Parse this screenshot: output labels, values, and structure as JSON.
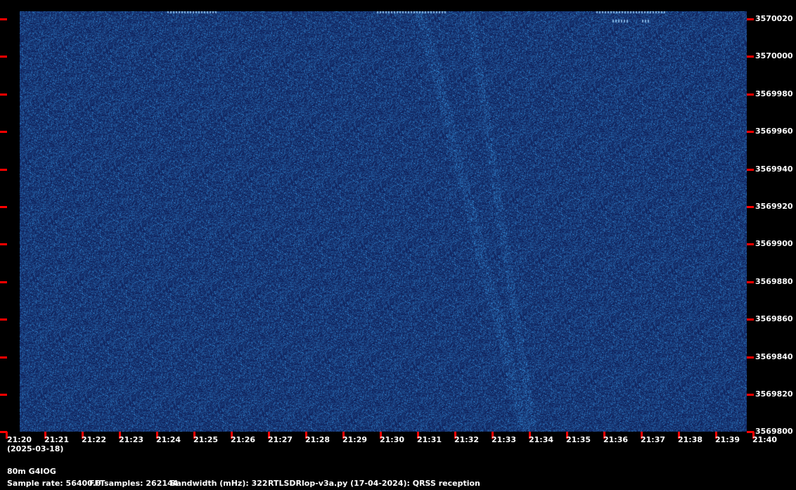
{
  "chart_data": {
    "type": "heatmap",
    "description_axis_x": "time",
    "x_ticks": [
      "21:20",
      "21:21",
      "21:22",
      "21:23",
      "21:24",
      "21:25",
      "21:26",
      "21:27",
      "21:28",
      "21:29",
      "21:30",
      "21:31",
      "21:32",
      "21:33",
      "21:34",
      "21:35",
      "21:36",
      "21:37",
      "21:38",
      "21:39",
      "21:40"
    ],
    "y_ticks": [
      "3570020",
      "3570000",
      "3569980",
      "3569960",
      "3569940",
      "3569920",
      "3569900",
      "3569880",
      "3569860",
      "3569840",
      "3569820",
      "3569800"
    ],
    "colors": {
      "background": "#0f1f5c",
      "noise_light": "#3a7ab0",
      "tick": "#ff0000"
    }
  },
  "footer": {
    "date": "(2025-03-18)",
    "station": "80m G4IOG",
    "sample_rate": "Sample rate: 56400.0",
    "fft_samples": "FFTsamples: 262144",
    "bandwidth": "Bandwidth (mHz): 322",
    "software": "RTLSDRlop-v3a.py (17-04-2024): QRSS reception"
  }
}
